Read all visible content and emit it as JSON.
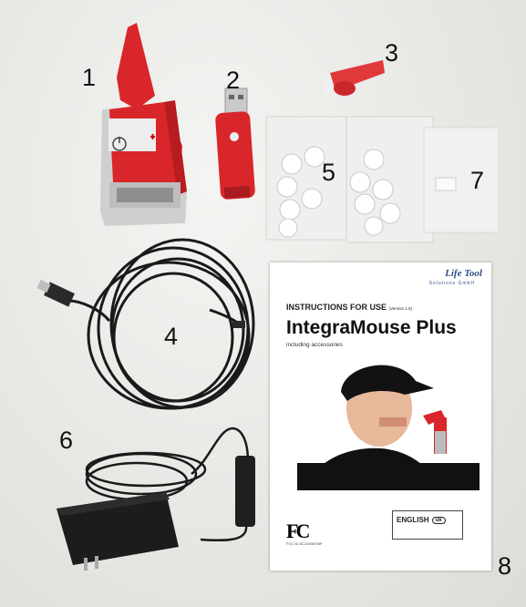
{
  "labels": {
    "item1": "1",
    "item2": "2",
    "item3": "3",
    "item4": "4",
    "item5": "5",
    "item6": "6",
    "item7": "7",
    "item8": "8"
  },
  "manual": {
    "brand": "Life Tool",
    "brand_sub": "Solutions GmbH",
    "heading": "INSTRUCTIONS FOR USE",
    "version": "(Version 1.0)",
    "title": "IntegraMouse Plus",
    "subtitle": "including accessories",
    "fcc_logo": "FC",
    "fcc_id": "FCC ID:SC10008TMP",
    "language": "ENGLISH",
    "language_code": "uk"
  },
  "colors": {
    "device_red": "#d8262a",
    "cable_black": "#1a1a1a",
    "background": "#e9e9e7"
  }
}
